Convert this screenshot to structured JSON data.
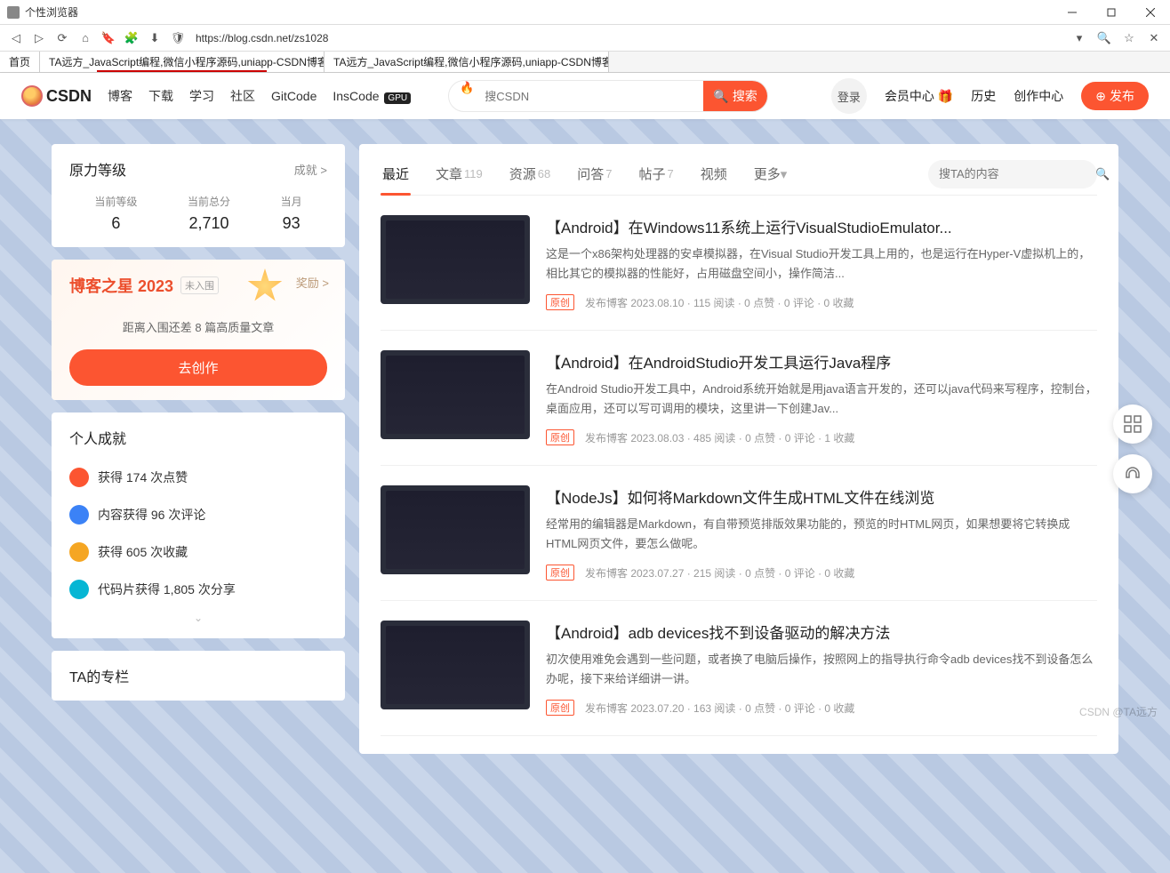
{
  "window": {
    "title": "个性浏览器"
  },
  "url": "https://blog.csdn.net/zs1028",
  "tabs": {
    "home": "首页",
    "tab1": "TA远方_JavaScript编程,微信小程序源码,uniapp-CSDN博客",
    "tab2": "TA远方_JavaScript编程,微信小程序源码,uniapp-CSDN博客"
  },
  "nav": {
    "logo": "CSDN",
    "items": [
      "博客",
      "下载",
      "学习",
      "社区",
      "GitCode",
      "InsCode"
    ],
    "gpu": "GPU",
    "search_placeholder": "搜CSDN",
    "search_btn": "搜索",
    "login": "登录",
    "right": [
      "会员中心",
      "历史",
      "创作中心"
    ],
    "publish": "发布"
  },
  "level": {
    "title": "原力等级",
    "more": "成就 >",
    "stats": [
      {
        "lbl": "当前等级",
        "val": "6"
      },
      {
        "lbl": "当前总分",
        "val": "2,710"
      },
      {
        "lbl": "当月",
        "val": "93"
      }
    ]
  },
  "star": {
    "title": "博客之星 2023",
    "tag": "未入围",
    "reward": "奖励 >",
    "desc": "距离入围还差 8 篇高质量文章",
    "btn": "去创作"
  },
  "achieve": {
    "title": "个人成就",
    "items": [
      "获得 174 次点赞",
      "内容获得 96 次评论",
      "获得 605 次收藏",
      "代码片获得 1,805 次分享"
    ]
  },
  "column_title": "TA的专栏",
  "main_tabs": [
    {
      "label": "最近",
      "cnt": ""
    },
    {
      "label": "文章",
      "cnt": "119"
    },
    {
      "label": "资源",
      "cnt": "68"
    },
    {
      "label": "问答",
      "cnt": "7"
    },
    {
      "label": "帖子",
      "cnt": "7"
    },
    {
      "label": "视频",
      "cnt": ""
    },
    {
      "label": "更多",
      "cnt": ""
    }
  ],
  "inner_search_placeholder": "搜TA的内容",
  "orig_tag": "原创",
  "articles": [
    {
      "title": "【Android】在Windows11系统上运行VisualStudioEmulator...",
      "desc": "这是一个x86架构处理器的安卓模拟器，在Visual Studio开发工具上用的，也是运行在Hyper-V虚拟机上的，相比其它的模拟器的性能好，占用磁盘空间小，操作简洁...",
      "meta": "发布博客 2023.08.10 · 115 阅读 · 0 点赞 · 0 评论 · 0 收藏"
    },
    {
      "title": "【Android】在AndroidStudio开发工具运行Java程序",
      "desc": "在Android Studio开发工具中，Android系统开始就是用java语言开发的，还可以java代码来写程序，控制台，桌面应用，还可以写可调用的模块，这里讲一下创建Jav...",
      "meta": "发布博客 2023.08.03 · 485 阅读 · 0 点赞 · 0 评论 · 1 收藏"
    },
    {
      "title": "【NodeJs】如何将Markdown文件生成HTML文件在线浏览",
      "desc": "经常用的编辑器是Markdown，有自带预览排版效果功能的，预览的时HTML网页，如果想要将它转换成HTML网页文件，要怎么做呢。",
      "meta": "发布博客 2023.07.27 · 215 阅读 · 0 点赞 · 0 评论 · 0 收藏"
    },
    {
      "title": "【Android】adb devices找不到设备驱动的解决方法",
      "desc": "初次使用难免会遇到一些问题，或者换了电脑后操作，按照网上的指导执行命令adb devices找不到设备怎么办呢，接下来给详细讲一讲。",
      "meta": "发布博客 2023.07.20 · 163 阅读 · 0 点赞 · 0 评论 · 0 收藏"
    }
  ],
  "watermark": "CSDN @TA远方"
}
